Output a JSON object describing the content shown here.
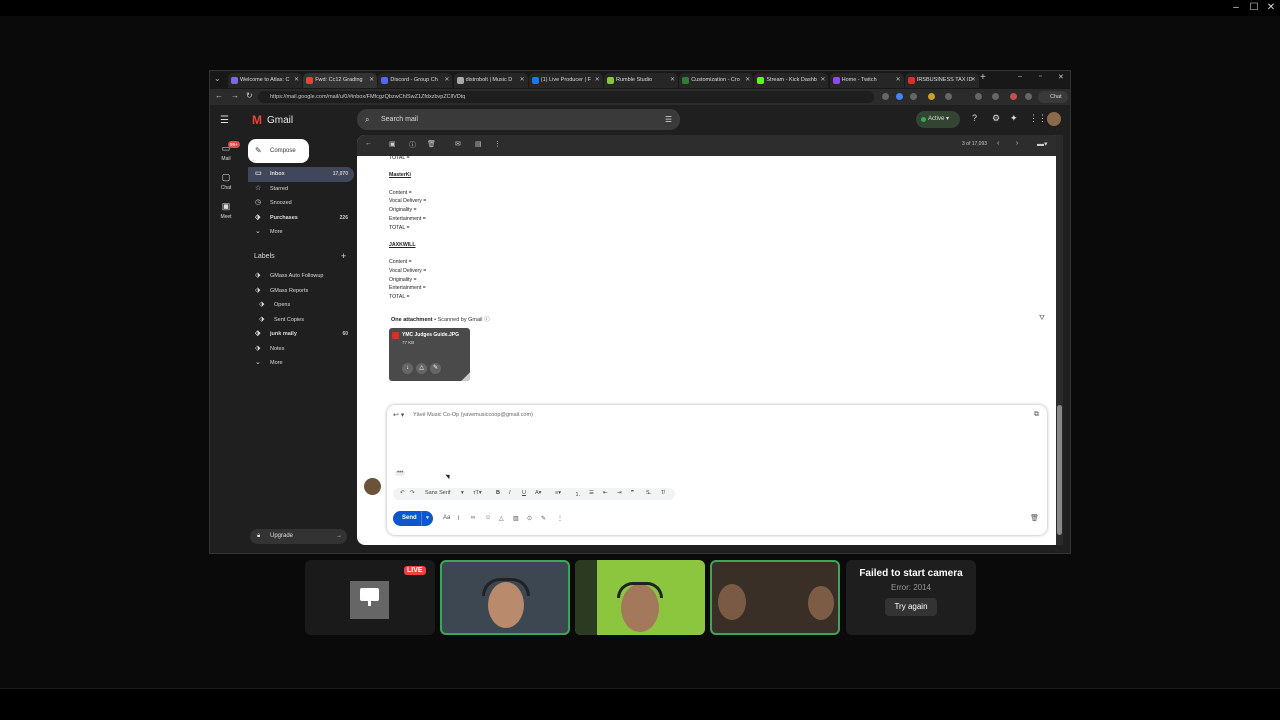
{
  "browser": {
    "tabs": [
      {
        "label": "Welcome to Atlas: C",
        "color": "#7b68ee"
      },
      {
        "label": "Fwd: Cc12 Grading ",
        "color": "#ea4335"
      },
      {
        "label": "Discord - Group Ch",
        "color": "#5865f2"
      },
      {
        "label": "distrobolt | Music D",
        "color": "#aaaaaa"
      },
      {
        "label": "(1) Live Producer | F",
        "color": "#1877f2"
      },
      {
        "label": "Rumble Studio",
        "color": "#85c742"
      },
      {
        "label": "Customization - Cro",
        "color": "#2e7d32"
      },
      {
        "label": "Stream - Kick Dashb",
        "color": "#53fc18"
      },
      {
        "label": "Home - Twitch",
        "color": "#9146ff"
      },
      {
        "label": "IRSBUSINESS TAX ID",
        "color": "#d93025"
      }
    ],
    "url": "https://mail.google.com/mail/u/0/#inbox/FMfcgzQbzwChlSwZ1ZfdxzbvpZCllVDtq",
    "chat_label": "Chat"
  },
  "gmail": {
    "brand": "Gmail",
    "search_placeholder": "Search mail",
    "status": "Active",
    "rail": [
      {
        "icon": "mail-icon",
        "label": "Mail",
        "badge": "99+"
      },
      {
        "icon": "chat-icon",
        "label": "Chat"
      },
      {
        "icon": "meet-icon",
        "label": "Meet"
      }
    ],
    "compose_label": "Compose",
    "nav": [
      {
        "label": "Inbox",
        "count": "17,070",
        "selected": true,
        "bold": true,
        "icon": "inbox-icon"
      },
      {
        "label": "Starred",
        "count": "",
        "icon": "star-icon"
      },
      {
        "label": "Snoozed",
        "count": "",
        "icon": "clock-icon"
      },
      {
        "label": "Purchases",
        "count": "226",
        "bold": true,
        "icon": "tag-icon"
      },
      {
        "label": "More",
        "count": "",
        "icon": "chevron-down-icon"
      }
    ],
    "labels_heading": "Labels",
    "labels": [
      {
        "label": "GMass Auto Followup",
        "indent": 0
      },
      {
        "label": "GMass Reports",
        "indent": 0
      },
      {
        "label": "Opens",
        "indent": 1
      },
      {
        "label": "Sent Copies",
        "indent": 1
      },
      {
        "label": "junk maily",
        "indent": 0,
        "count": "60",
        "bold": true
      },
      {
        "label": "Notes",
        "indent": 0
      },
      {
        "label": "More",
        "indent": 0
      }
    ],
    "upgrade_label": "Upgrade",
    "pagination": "3 of 17,093",
    "body_lines": [
      {
        "t": "TOTAL =",
        "hdr": false
      },
      {
        "t": "",
        "hdr": false
      },
      {
        "t": "MasterKi",
        "hdr": true
      },
      {
        "t": "",
        "hdr": false
      },
      {
        "t": "Content =",
        "hdr": false
      },
      {
        "t": "Vocal Delivery =",
        "hdr": false
      },
      {
        "t": "Originality =",
        "hdr": false
      },
      {
        "t": "Entertainment =",
        "hdr": false
      },
      {
        "t": "TOTAL =",
        "hdr": false
      },
      {
        "t": "",
        "hdr": false
      },
      {
        "t": "JAXKWILL",
        "hdr": true
      },
      {
        "t": "",
        "hdr": false
      },
      {
        "t": "Content =",
        "hdr": false
      },
      {
        "t": "Vocal Delivery =",
        "hdr": false
      },
      {
        "t": "Originality =",
        "hdr": false
      },
      {
        "t": "Entertainment =",
        "hdr": false
      },
      {
        "t": "TOTAL =",
        "hdr": false
      }
    ],
    "attachment_heading": "One attachment",
    "attachment_scan": "• Scanned by Gmail",
    "attachment_name": "YMC Judges Guide.JPG",
    "attachment_size": "77 KB",
    "reply_to": "Yāvé Music Co-Op (yavemusiccoop@gmail.com)",
    "reply_dots": "•••",
    "font_name": "Sans Serif",
    "send_label": "Send"
  },
  "call": {
    "live_label": "LIVE",
    "cam_fail_title": "Failed to start camera",
    "cam_fail_error": "Error: 2014",
    "try_again": "Try again"
  }
}
